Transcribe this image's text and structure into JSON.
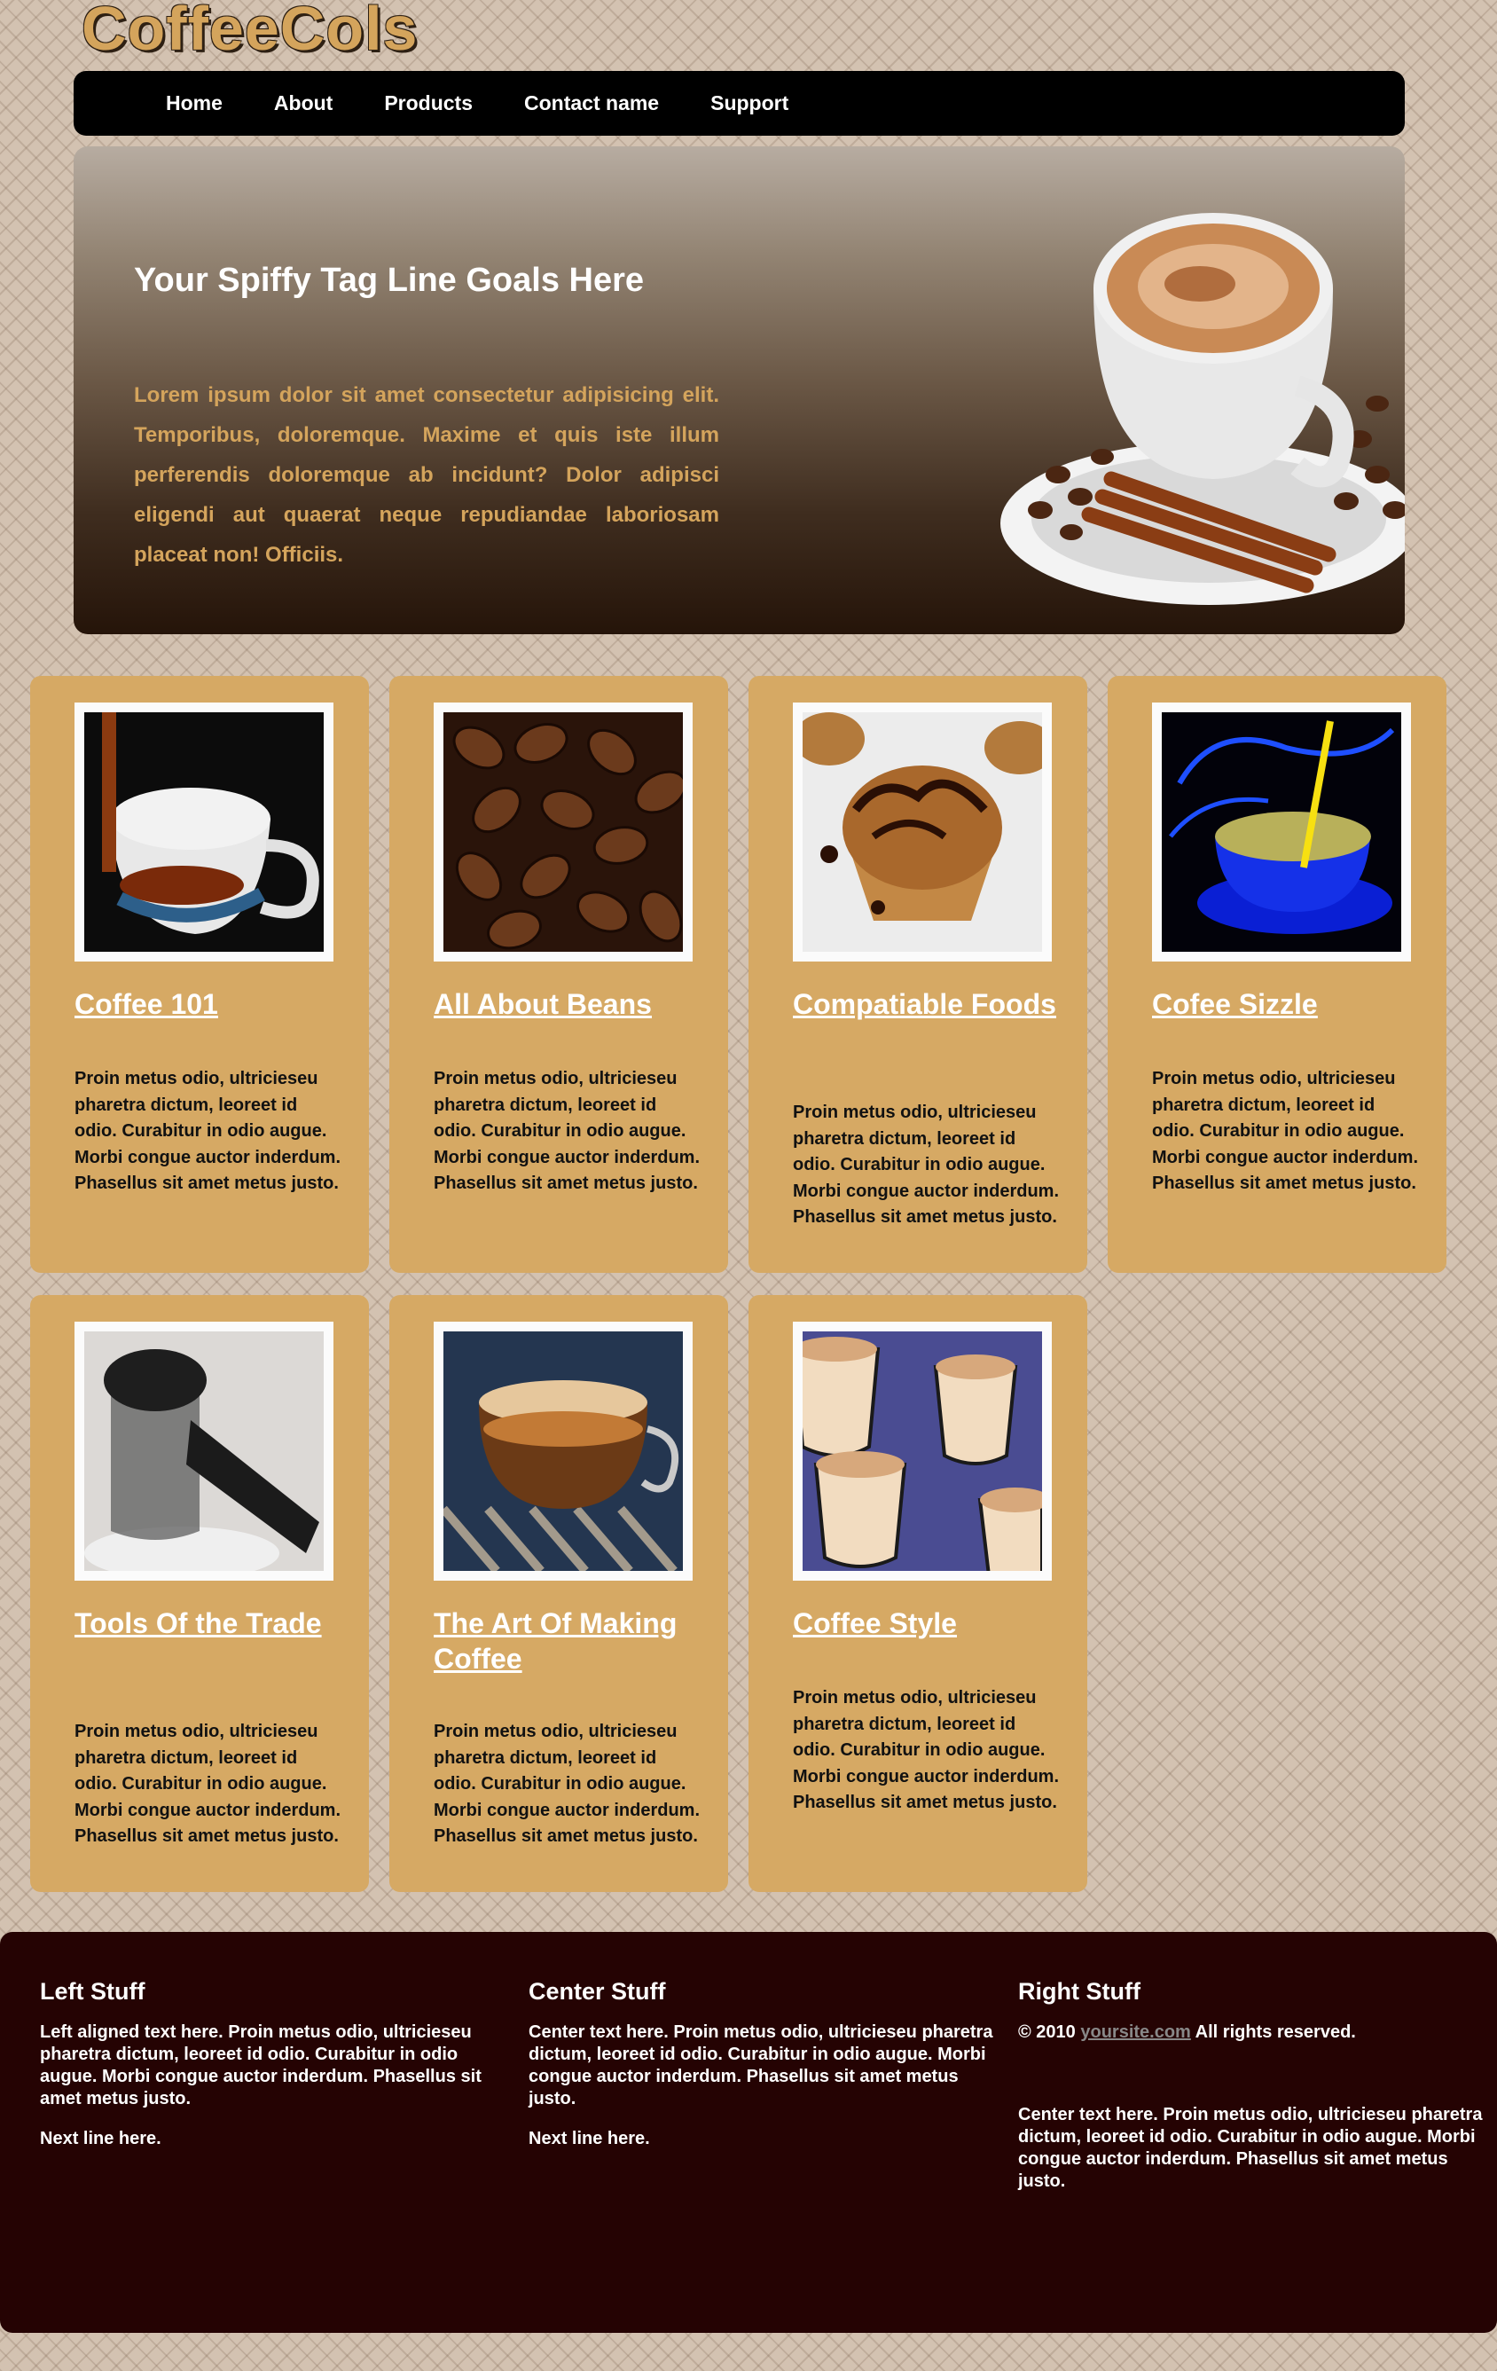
{
  "site": {
    "logo": "CoffeeCols"
  },
  "nav": {
    "items": [
      "Home",
      "About",
      "Products",
      "Contact name",
      "Support"
    ]
  },
  "hero": {
    "title": "Your Spiffy Tag Line Goals Here",
    "text": "Lorem ipsum dolor sit amet consectetur adipisicing elit. Temporibus, doloremque. Maxime et quis iste illum perferendis doloremque ab incidunt? Dolor adipisci eligendi aut quaerat neque repudiandae laboriosam placeat non! Officiis."
  },
  "cards": [
    {
      "title": "Coffee 101",
      "text": "Proin metus odio, ultriciesеu pharetra dictum, leoreet id odio. Curabitur in odio augue. Morbi congue auctor inderdum. Phasellus sit amet metus justo.",
      "image": "tea-pour-photo"
    },
    {
      "title": "All About Beans",
      "text": "Proin metus odio, ultriciesеu pharetra dictum, leoreet id odio. Curabitur in odio augue. Morbi congue auctor inderdum. Phasellus sit amet metus justo.",
      "image": "coffee-beans-photo"
    },
    {
      "title": "Compatiable Foods",
      "text": "Proin metus odio, ultriciesеu pharetra dictum, leoreet id odio. Curabitur in odio augue. Morbi congue auctor inderdum. Phasellus sit amet metus justo.",
      "image": "muffin-photo"
    },
    {
      "title": "Cofee Sizzle",
      "text": "Proin metus odio, ultriciesеu pharetra dictum, leoreet id odio. Curabitur in odio augue. Morbi congue auctor inderdum. Phasellus sit amet metus justo.",
      "image": "blue-cup-photo"
    },
    {
      "title": "Tools Of the Trade",
      "text": "Proin metus odio, ultriciesеu pharetra dictum, leoreet id odio. Curabitur in odio augue. Morbi congue auctor inderdum. Phasellus sit amet metus justo.",
      "image": "coffee-pot-photo"
    },
    {
      "title": "The Art Of Making Coffee",
      "text": "Proin metus odio, ultriciesеu pharetra dictum, leoreet id odio. Curabitur in odio augue. Morbi congue auctor inderdum. Phasellus sit amet metus justo.",
      "image": "espresso-photo"
    },
    {
      "title": "Coffee Style",
      "text": "Proin metus odio, ultriciesеu pharetra dictum, leoreet id odio. Curabitur in odio augue. Morbi congue auctor inderdum. Phasellus sit amet metus justo.",
      "image": "cups-photo"
    }
  ],
  "footer": {
    "left": {
      "title": "Left Stuff",
      "text": "Left aligned text here. Proin metus odio, ultriciesеu pharetra dictum, leoreet id odio. Curabitur in odio augue. Morbi congue auctor inderdum. Phasellus sit amet metus justo.",
      "line": "Next line here."
    },
    "center": {
      "title": "Center Stuff",
      "text": "Center text here. Proin metus odio, ultriciesеu pharetra dictum, leoreet id odio. Curabitur in odio augue. Morbi congue auctor inderdum. Phasellus sit amet metus justo.",
      "line": "Next line here."
    },
    "right": {
      "title": "Right Stuff",
      "copyright": "© 2010",
      "link": "yoursite.com",
      "rights": "All rights reserved.",
      "text": "Center text here. Proin metus odio, ultriciesеu pharetra dictum, leoreet id odio. Curabitur in odio augue. Morbi congue auctor inderdum. Phasellus sit amet metus justo."
    }
  },
  "colors": {
    "accent": "#d6a964",
    "nav": "#000000",
    "footer": "#250303"
  }
}
